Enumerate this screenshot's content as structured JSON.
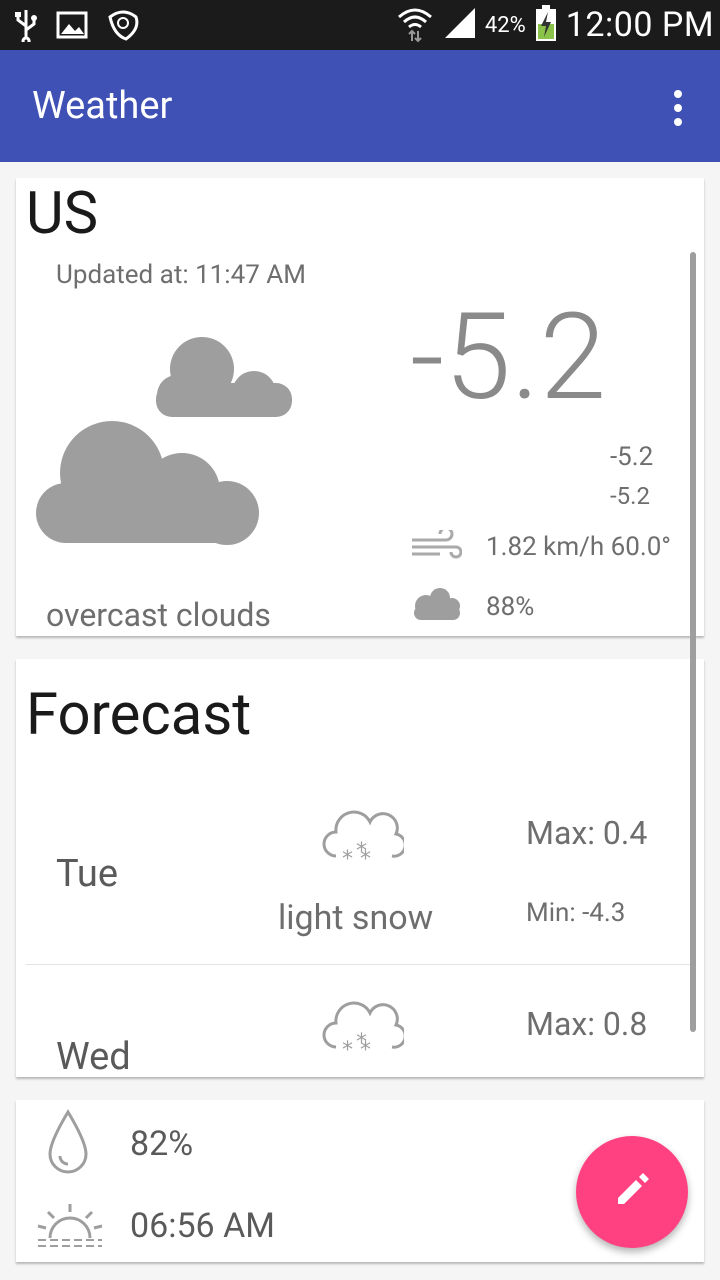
{
  "status_bar": {
    "icons": [
      "usb-icon",
      "image-icon",
      "app-icon",
      "wifi-icon",
      "signal-icon",
      "battery-icon"
    ],
    "battery_percent": "42%",
    "time": "12:00 PM"
  },
  "app_bar": {
    "title": "Weather",
    "menu_icon": "more-vertical-icon"
  },
  "current": {
    "city": "US",
    "updated": "Updated at: 11:47 AM",
    "temperature": "-5.2",
    "temp_max": "-5.2",
    "temp_min": "-5.2",
    "wind": "1.82 km/h 60.0°",
    "clouds": "88%",
    "description": "overcast clouds",
    "icon": "overcast-clouds-icon"
  },
  "forecast": {
    "title": "Forecast",
    "days": [
      {
        "day": "Tue",
        "description": "light snow",
        "max": "Max: 0.4",
        "min": "Min: -4.3",
        "icon": "snow-icon"
      },
      {
        "day": "Wed",
        "description": "",
        "max": "Max: 0.8",
        "min": "",
        "icon": "snow-icon"
      }
    ]
  },
  "details": {
    "humidity": "82%",
    "sunrise": "06:56 AM"
  },
  "fab": {
    "icon": "edit-icon"
  },
  "colors": {
    "primary": "#3f51b5",
    "accent": "#ff4081",
    "status_bar": "#1b1b1b"
  }
}
